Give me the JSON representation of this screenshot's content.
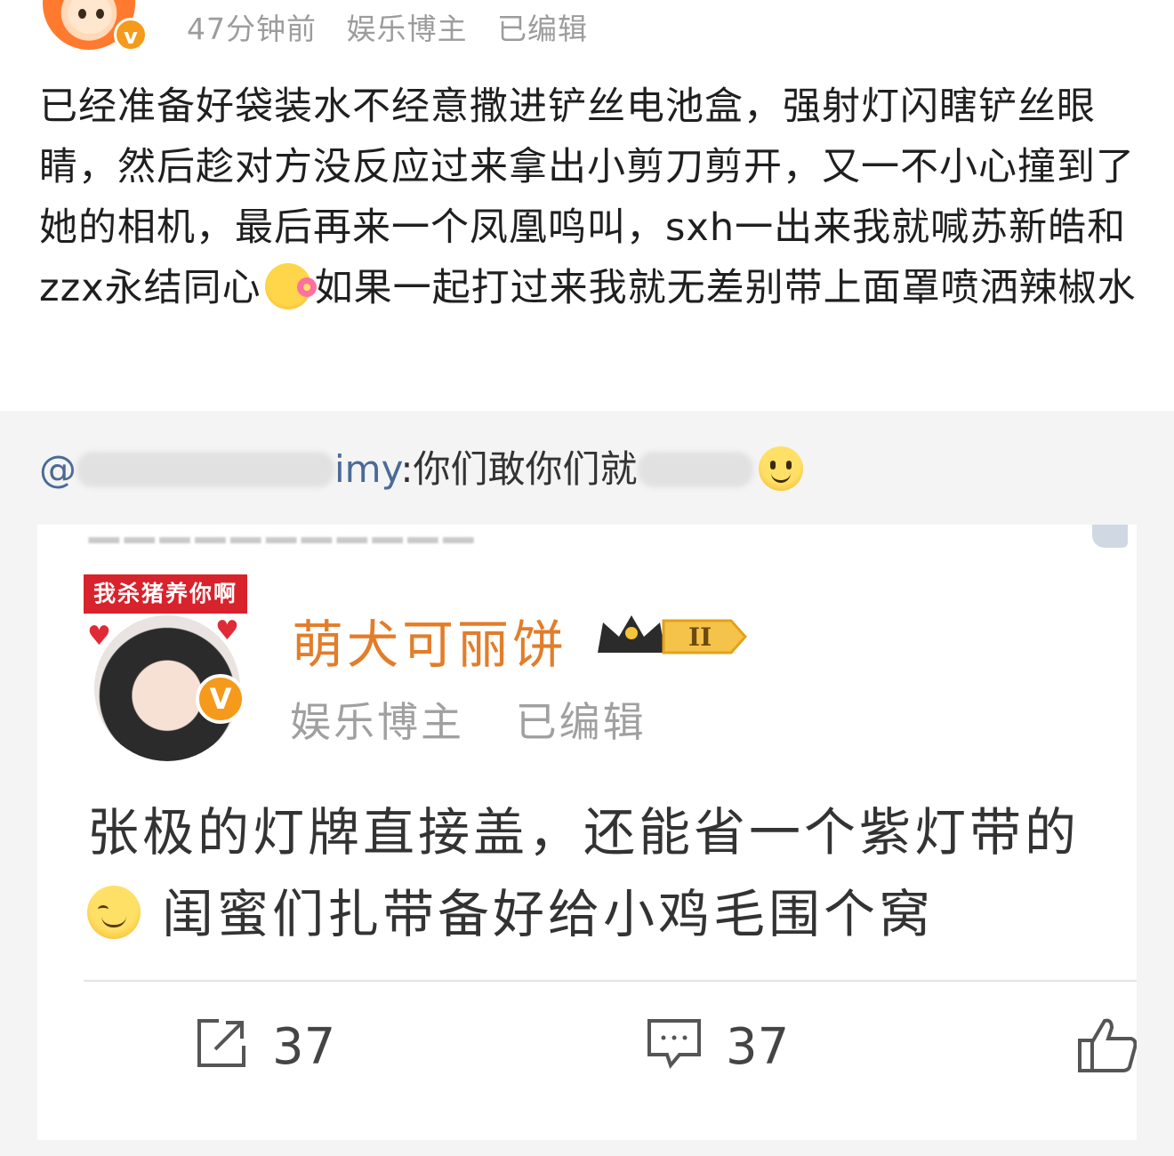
{
  "post": {
    "time": "47分钟前",
    "author_type": "娱乐博主",
    "edited": "已编辑",
    "verified_badge": "v",
    "text_part1": "已经准备好袋装水不经意撒进铲丝电池盒，强射灯闪瞎铲丝眼睛，然后趁对方没反应过来拿出小剪刀剪开，又一不小心撞到了她的相机，最后再来一个凤凰鸣叫，sxh一出来我就喊苏新皓和zzx永结同心",
    "text_part2": "如果一起打过来我就无差别带上面罩喷洒辣椒水"
  },
  "repost": {
    "mention_prefix": "@",
    "mention_suffix": "imy",
    "quote_visible": ":你们敢你们就"
  },
  "screenshot_card": {
    "avatar_banner": "我杀猪养你啊",
    "name": "萌犬可丽饼",
    "level": "II",
    "author_type": "娱乐博主",
    "edited": "已编辑",
    "text_line1": "张极的灯牌直接盖，还能省一个紫灯带的",
    "text_line2": "闺蜜们扎带备好给小鸡毛围个窝",
    "share_count": "37",
    "comment_count": "37"
  },
  "colors": {
    "accent_orange": "#f59a1b",
    "mention_blue": "#4b6a96",
    "name_orange": "#e27d2a",
    "banner_red": "#d8222c"
  }
}
